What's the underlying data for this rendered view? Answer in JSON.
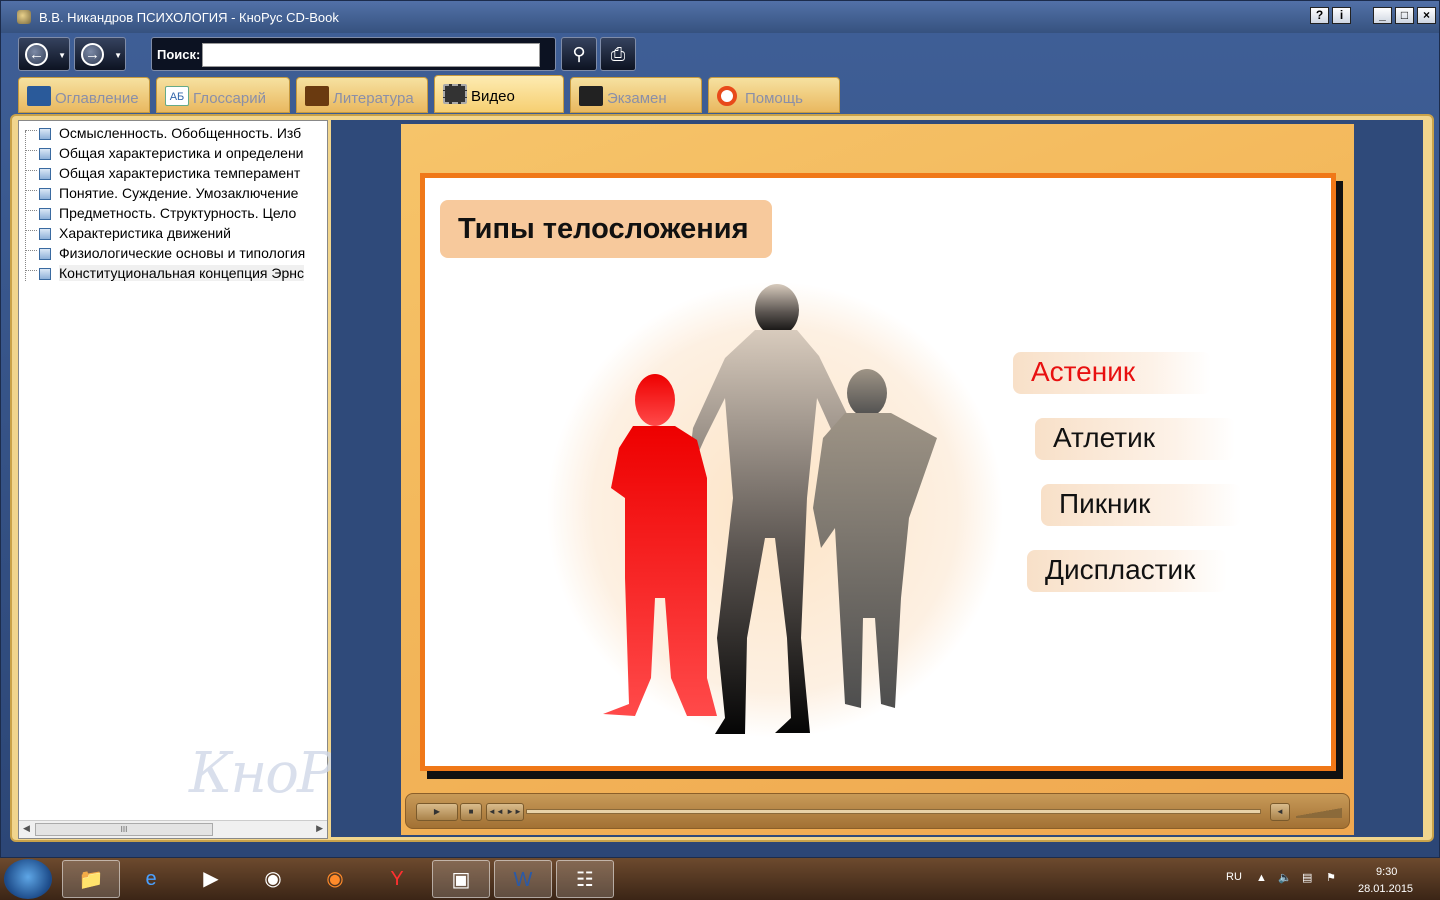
{
  "window": {
    "title": "В.В. Никандров ПСИХОЛОГИЯ - КноРус CD-Book",
    "buttons": [
      "?",
      "i",
      "_",
      "□",
      "×"
    ]
  },
  "toolbar": {
    "search_label": "Поиск:",
    "search_value": "",
    "back_icon": "arrow-left-icon",
    "forward_icon": "arrow-right-icon"
  },
  "tabs": [
    {
      "label": "Оглавление",
      "icon": "book-icon",
      "active": false
    },
    {
      "label": "Глоссарий",
      "icon": "abc-icon",
      "active": false
    },
    {
      "label": "Литература",
      "icon": "books-icon",
      "active": false
    },
    {
      "label": "Видео",
      "icon": "film-icon",
      "active": true
    },
    {
      "label": "Экзамен",
      "icon": "graduation-cap-icon",
      "active": false
    },
    {
      "label": "Помощь",
      "icon": "lifebuoy-icon",
      "active": false
    }
  ],
  "sidebar": {
    "items": [
      "Осмысленность. Обобщенность. Изб",
      "Общая характеристика и определени",
      "Общая характеристика темперамент",
      "Понятие. Суждение. Умозаключение",
      "Предметность. Структурность. Цело",
      "Характеристика движений",
      "Физиологические основы и типология",
      "Конституциональная концепция Эрнс"
    ],
    "watermark": "КноРус",
    "scroll_thumb": "III"
  },
  "slide": {
    "title": "Типы телосложения",
    "types": [
      "Астеник",
      "Атлетик",
      "Пикник",
      "Диспластик"
    ],
    "highlight_color": "#e81010"
  },
  "taskbar": {
    "lang": "RU",
    "time": "9:30",
    "date": "28.01.2015"
  }
}
